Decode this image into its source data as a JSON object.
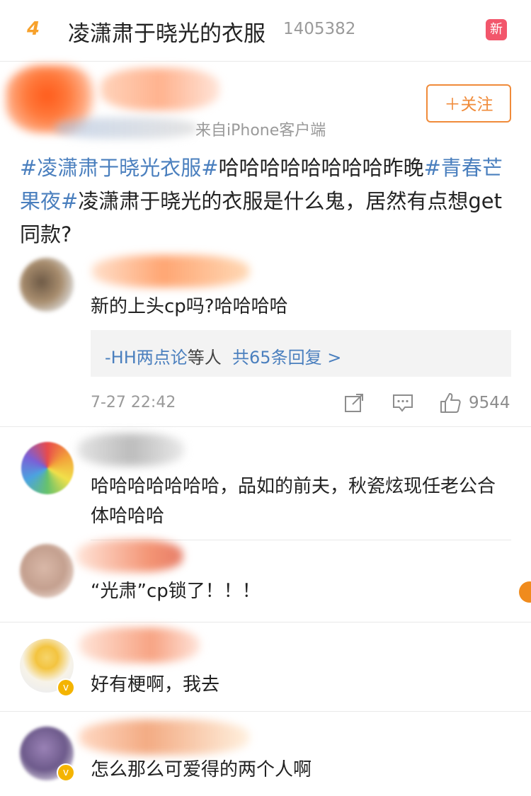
{
  "trend": {
    "rank": "4",
    "topic": "凌潇肃于晓光的衣服",
    "heat": "1405382",
    "badge": "新"
  },
  "post": {
    "meta_source": "来自iPhone客户端",
    "follow_label": "＋关注",
    "text": {
      "tag1": "#凌潇肃于晓光衣服#",
      "plain1": "哈哈哈哈哈哈哈哈昨晚",
      "tag2": "#青春芒果夜#",
      "plain2": "凌潇肃于晓光的衣服是什么鬼，居然有点想get同款?"
    }
  },
  "comments": [
    {
      "text": "新的上头cp吗?哈哈哈哈",
      "replies_summary": {
        "author": "-HH两点论",
        "middle": "等人",
        "count_label": "共65条回复 >"
      },
      "time": "7-27 22:42",
      "likes": "9544"
    },
    {
      "text": "哈哈哈哈哈哈哈，品如的前夫，秋瓷炫现任老公合体哈哈哈"
    },
    {
      "text": "“光肃”cp锁了！！！"
    },
    {
      "text": "好有梗啊，我去"
    },
    {
      "text": "怎么那么可爱得的两个人啊"
    }
  ],
  "icons": {
    "share": "share-icon",
    "comment": "comment-icon",
    "like": "thumbs-up-icon",
    "verified": "verified-badge-icon"
  },
  "colors": {
    "accent_orange": "#f08b3a",
    "topic_blue": "#4a7fbe",
    "new_badge": "#f2566b",
    "rank_orange": "#f7a12b"
  }
}
